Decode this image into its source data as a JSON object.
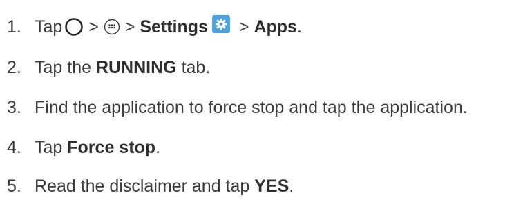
{
  "steps": [
    {
      "number": "1.",
      "text_tap": "Tap",
      "sep1": " > ",
      "sep2": " > ",
      "settings_label": "Settings",
      "sep3": " > ",
      "apps_label": "Apps",
      "end": "."
    },
    {
      "number": "2.",
      "text_pre": "Tap the ",
      "bold": "RUNNING",
      "text_post": " tab."
    },
    {
      "number": "3.",
      "text": "Find the application to force stop and tap the application."
    },
    {
      "number": "4.",
      "text_pre": "Tap ",
      "bold": "Force stop",
      "text_post": "."
    },
    {
      "number": "5.",
      "text_pre": "Read the disclaimer and tap ",
      "bold": "YES",
      "text_post": "."
    }
  ],
  "icons": {
    "home": "home-circle-icon",
    "apps": "apps-grid-icon",
    "settings": "gear-icon"
  },
  "colors": {
    "text": "#3a3a3a",
    "settings_icon_bg": "#4aa3df"
  }
}
